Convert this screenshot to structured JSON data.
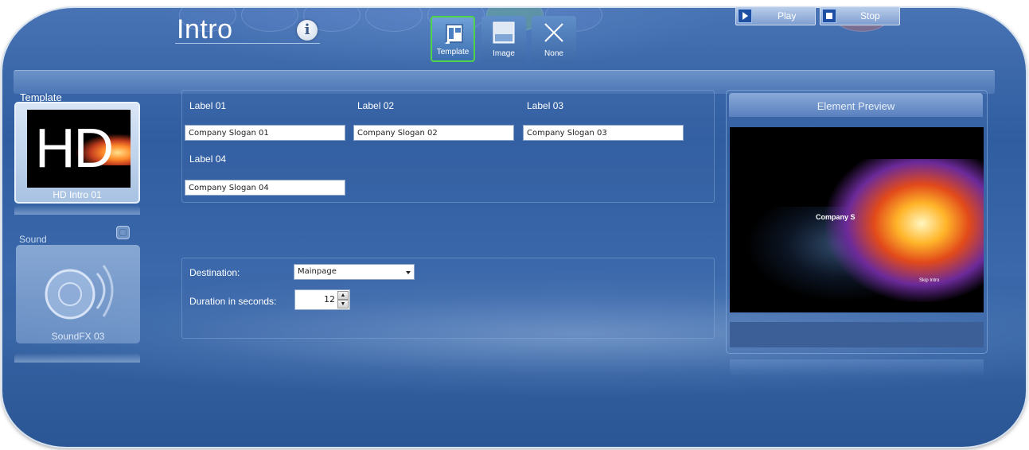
{
  "header": {
    "title": "Intro"
  },
  "tabs": [
    {
      "label": "Template",
      "active": true
    },
    {
      "label": "Image",
      "active": false
    },
    {
      "label": "None",
      "active": false
    }
  ],
  "left": {
    "template_title": "Template",
    "template_item": "HD Intro 01",
    "thumb_text": "HD",
    "sound_title": "Sound",
    "sound_item": "SoundFX 03"
  },
  "form": {
    "labels": [
      "Label 01",
      "Label 02",
      "Label 03",
      "Label 04"
    ],
    "values": [
      "Company Slogan 01",
      "Company Slogan 02",
      "Company Slogan 03",
      "Company Slogan 04"
    ],
    "destination_label": "Destination:",
    "destination_value": "Mainpage",
    "duration_label": "Duration in seconds:",
    "duration_value": "12"
  },
  "preview": {
    "title": "Element Preview",
    "video_slogan": "Company S",
    "video_skip": "Skip Intro",
    "play_label": "Play",
    "stop_label": "Stop"
  },
  "colors": {
    "active_tab_border": "#4ed34a",
    "background": "#3a68aa"
  }
}
